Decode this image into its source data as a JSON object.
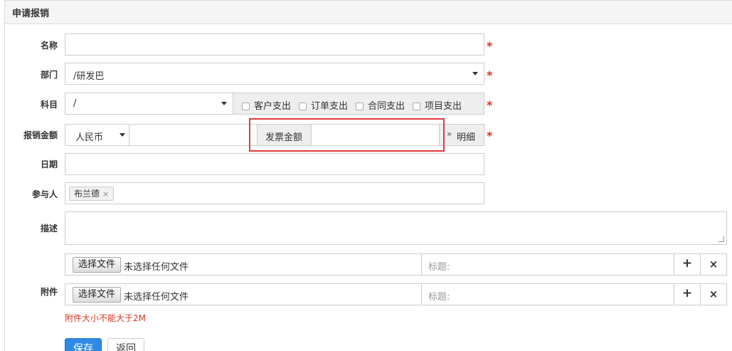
{
  "panel": {
    "title": "申请报销"
  },
  "form": {
    "name": {
      "label": "名称",
      "value": "",
      "required": "*"
    },
    "department": {
      "label": "部门",
      "value": "/研发巴",
      "required": "*"
    },
    "subject": {
      "label": "科目",
      "value": "/",
      "required": "*",
      "checkboxes": [
        "客户支出",
        "订单支出",
        "合同支出",
        "项目支出"
      ]
    },
    "amount": {
      "label": "报销金额",
      "currency": "人民币",
      "value": "",
      "invoice_label": "发票金额",
      "invoice_value": "",
      "detail_toggle": "明细",
      "required": "*"
    },
    "date": {
      "label": "日期",
      "value": ""
    },
    "participants": {
      "label": "参与人",
      "tags": [
        "布兰德"
      ],
      "remove_glyph": "×"
    },
    "description": {
      "label": "描述",
      "value": ""
    },
    "attachments": {
      "label": "附件",
      "rows": [
        {
          "button": "选择文件",
          "status": "未选择任何文件",
          "title_placeholder": "标题:"
        },
        {
          "button": "选择文件",
          "status": "未选择任何文件",
          "title_placeholder": "标题:"
        }
      ],
      "add_glyph": "+",
      "remove_glyph": "×",
      "hint": "附件大小不能大于2M"
    }
  },
  "actions": {
    "save": "保存",
    "back": "返回"
  },
  "colors": {
    "required": "#d9331f",
    "primary": "#2f8ae5",
    "highlight": "#e03a3a"
  }
}
